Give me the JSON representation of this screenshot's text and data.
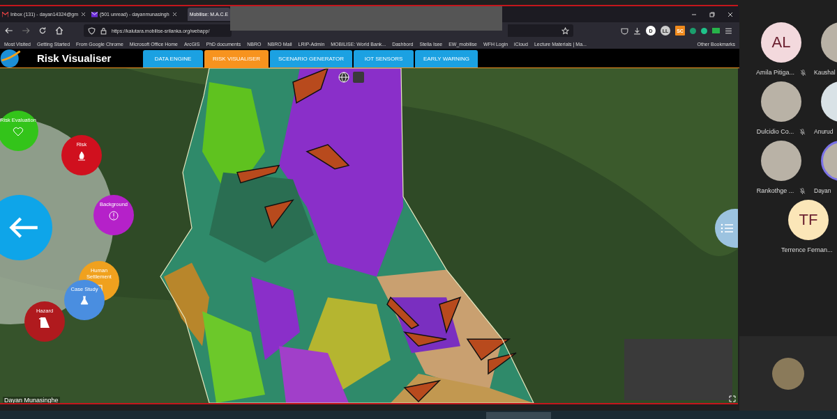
{
  "browser": {
    "tabs": [
      {
        "label": "Inbox (131) - dayan14324@gm",
        "selected": false
      },
      {
        "label": "(501 unread) - dayanmunasingh",
        "selected": false
      },
      {
        "label": "Mobilise: M.A.C.E",
        "selected": true
      }
    ],
    "address": "https://kalutara.mobilise-srilanka.org/webapp/",
    "extensions": [
      "D",
      "LL",
      "SC"
    ],
    "bookmarks": [
      "Most Visited",
      "Getting Started",
      "From Google Chrome",
      "Microsoft Office Home",
      "ArcGIS",
      "PhD documents",
      "NBRO",
      "NBRO Mail",
      "LRIP-Admin",
      "MOBILISE: World Bank...",
      "Dashbord",
      "Stella Isee",
      "EW_mobilise",
      "WFH Login",
      "iCloud",
      "Lecture Materials | Ma..."
    ],
    "other_bookmarks": "Other Bookmarks"
  },
  "app": {
    "title": "Risk Visualiser",
    "nav": [
      {
        "label": "DATA ENGINE",
        "selected": false
      },
      {
        "label": "RISK VISUALISER",
        "selected": true
      },
      {
        "label": "SCENARIO GENERATOR",
        "selected": false
      },
      {
        "label": "IOT SENSORS",
        "selected": false
      },
      {
        "label": "EARLY WARNING",
        "selected": false
      }
    ],
    "radial_menu": [
      {
        "label": "Risk Evaluation",
        "color": "#33c41a"
      },
      {
        "label": "Risk",
        "color": "#d0101e"
      },
      {
        "label": "Background",
        "color": "#b521c9"
      },
      {
        "label": "Human Settlement",
        "color": "#f0a11e"
      },
      {
        "label": "Case Study",
        "color": "#4a8ee0"
      },
      {
        "label": "Hazard",
        "color": "#b01a1e"
      }
    ],
    "presenter": "Dayan Munasinghe"
  },
  "participants": [
    {
      "name": "Amila Pitiga...",
      "kind": "initials",
      "initials": "AL",
      "color": "#f3d9dd",
      "muted": true,
      "speaking": false
    },
    {
      "name": "Kaushal",
      "kind": "photo",
      "muted": false,
      "speaking": false
    },
    {
      "name": "Dulcidio Co...",
      "kind": "photo",
      "muted": true,
      "speaking": false
    },
    {
      "name": "Anurud",
      "kind": "initials",
      "color": "#d9e2e6",
      "muted": false,
      "speaking": false
    },
    {
      "name": "Rankothge ...",
      "kind": "photo",
      "muted": true,
      "speaking": false
    },
    {
      "name": "Dayan",
      "kind": "photo",
      "muted": false,
      "speaking": true
    },
    {
      "name": "Terrence Fernan...",
      "kind": "initials",
      "initials": "TF",
      "color": "#fbe6b8",
      "muted": false,
      "speaking": false
    }
  ]
}
